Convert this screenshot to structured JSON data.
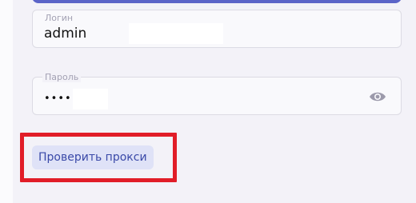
{
  "form": {
    "login": {
      "label": "Логин",
      "value": "admin"
    },
    "password": {
      "label": "Пароль",
      "value": "••••••",
      "toggle_icon": "eye-icon"
    },
    "check_proxy_button": "Проверить прокси"
  },
  "colors": {
    "accent": "#5b64c8",
    "button_bg": "#dfe2f7",
    "button_text": "#3a49a8",
    "highlight": "#e11d28"
  }
}
